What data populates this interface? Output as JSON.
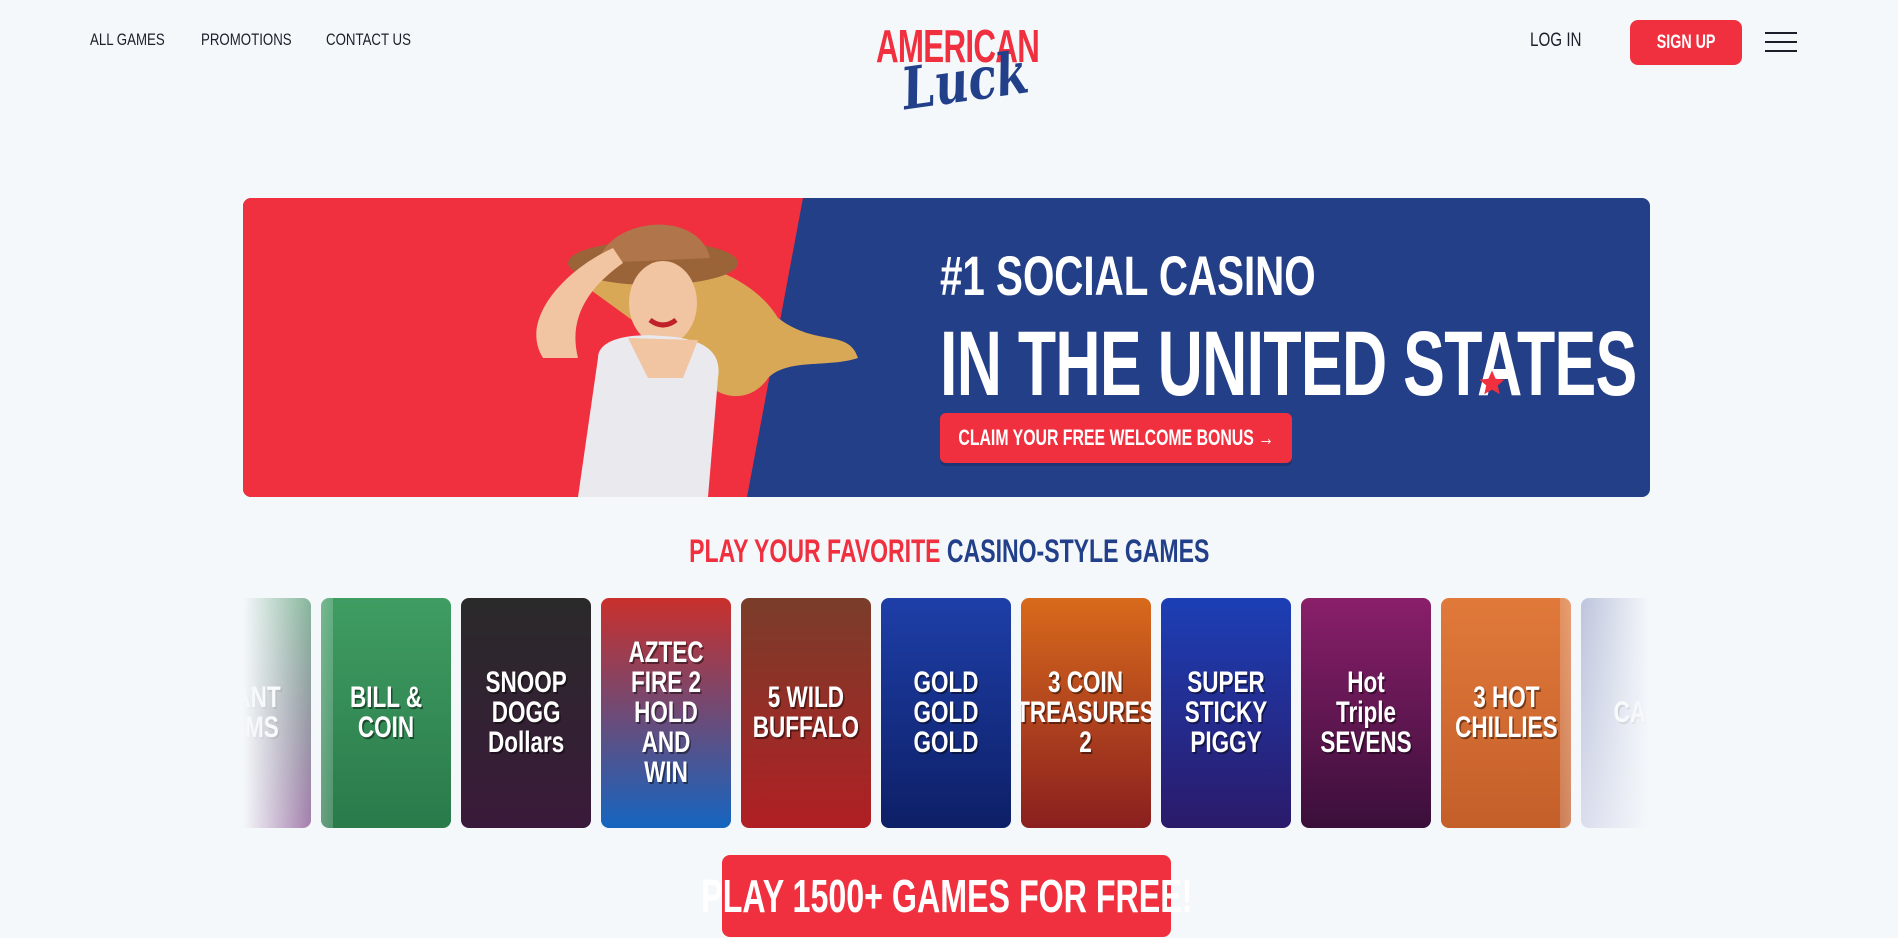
{
  "nav": {
    "items": [
      {
        "label": "ALL GAMES"
      },
      {
        "label": "PROMOTIONS"
      },
      {
        "label": "CONTACT US"
      }
    ]
  },
  "logo": {
    "top": "AMERICAN",
    "script": "Luck"
  },
  "header": {
    "login_label": "LOG IN",
    "signup_label": "SIGN UP"
  },
  "hero": {
    "line1": "#1 SOCIAL CASINO",
    "line2": "IN THE UNITED STATES",
    "cta_label": "CLAIM YOUR FREE WELCOME BONUS →"
  },
  "section": {
    "title_part1": "PLAY YOUR FAVORITE",
    "title_part2": "CASINO-STYLE GAMES"
  },
  "games": [
    {
      "title": "GIANT\nGEMS",
      "color_top": "#3d8a5a",
      "color_bottom": "#6f2f7a"
    },
    {
      "title": "BILL &\nCOIN",
      "color_top": "#3f9d62",
      "color_bottom": "#2a7a4a"
    },
    {
      "title": "SNOOP\nDOGG\nDollars",
      "color_top": "#2a2a2a",
      "color_bottom": "#3a1a3a"
    },
    {
      "title": "AZTEC FIRE 2\nHOLD AND WIN",
      "color_top": "#c9302c",
      "color_bottom": "#1565c0"
    },
    {
      "title": "5 WILD\nBUFFALO",
      "color_top": "#7a3d2a",
      "color_bottom": "#b01f24"
    },
    {
      "title": "GOLD GOLD\nGOLD",
      "color_top": "#1e3fa8",
      "color_bottom": "#0d1f66"
    },
    {
      "title": "3 COIN\nTREASURES 2",
      "color_top": "#d86a1c",
      "color_bottom": "#8a1f1f"
    },
    {
      "title": "SUPER\nSTICKY\nPIGGY",
      "color_top": "#1c3fb5",
      "color_bottom": "#2b1a6a"
    },
    {
      "title": "Hot Triple\nSEVENS",
      "color_top": "#8a1f6a",
      "color_bottom": "#3a0f3a"
    },
    {
      "title": "3 HOT\nCHILLIES",
      "color_top": "#e0793a",
      "color_bottom": "#c45f2a"
    },
    {
      "title": "CASH",
      "color_top": "#9aa3c9",
      "color_bottom": "#c9cde3"
    }
  ],
  "play_cta": {
    "label": "PLAY 1500+ GAMES FOR FREE!"
  },
  "colors": {
    "red": "#f0303f",
    "navy": "#22408a",
    "bg": "#f5f8fb"
  }
}
